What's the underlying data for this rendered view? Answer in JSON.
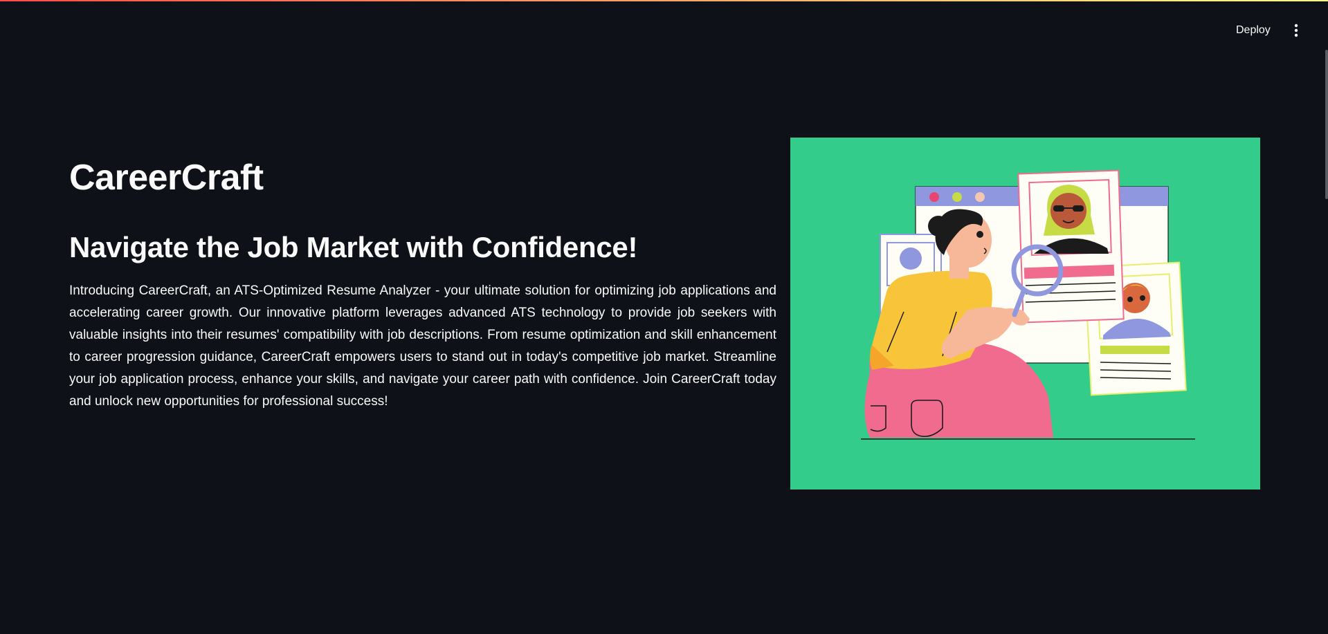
{
  "header": {
    "deploy_label": "Deploy",
    "menu_icon": "vertical-ellipsis-icon"
  },
  "main": {
    "title": "CareerCraft",
    "subtitle": "Navigate the Job Market with Confidence!",
    "description": "Introducing CareerCraft, an ATS-Optimized Resume Analyzer - your ultimate solution for optimizing job applications and accelerating career growth. Our innovative platform leverages advanced ATS technology to provide job seekers with valuable insights into their resumes' compatibility with job descriptions. From resume optimization and skill enhancement to career progression guidance, CareerCraft empowers users to stand out in today's competitive job market. Streamline your job application process, enhance your skills, and navigate your career path with confidence. Join CareerCraft today and unlock new opportunities for professional success!"
  },
  "colors": {
    "background": "#0e1117",
    "text": "#fafafa",
    "illustration_bg": "#34cc8a",
    "accent_gradient_start": "#ff4b4b",
    "accent_gradient_end": "#fffd80"
  }
}
